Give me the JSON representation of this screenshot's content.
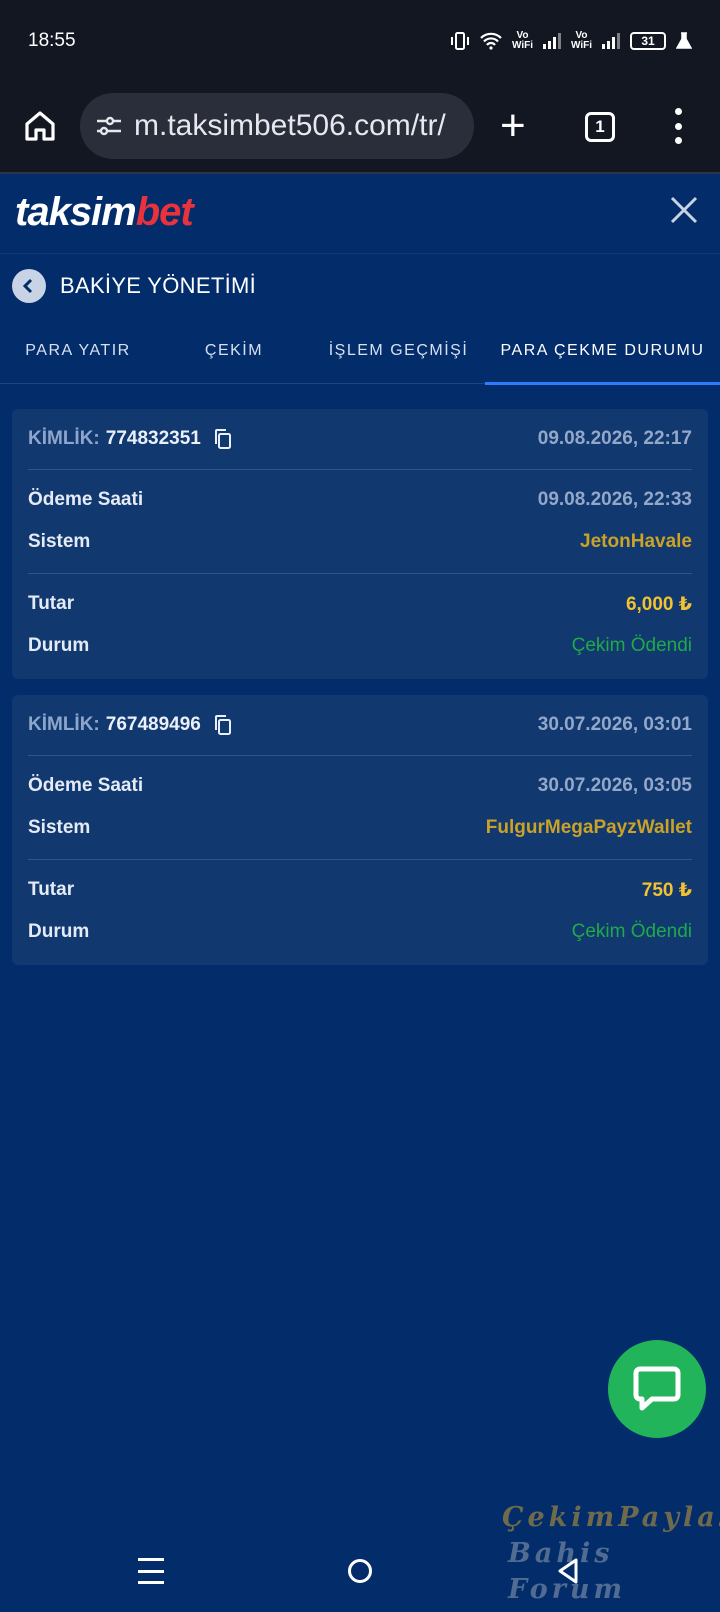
{
  "status_bar": {
    "time": "18:55",
    "vowifi_1": "Vo\nWiFi",
    "vowifi_2": "Vo\nWiFi",
    "battery": "31"
  },
  "browser": {
    "url": "m.taksimbet506.com/tr/",
    "tab_count": "1"
  },
  "site": {
    "logo_part1": "taksim",
    "logo_part2": "bet"
  },
  "page": {
    "title": "BAKİYE YÖNETİMİ",
    "tabs": [
      {
        "label": "PARA YATIR"
      },
      {
        "label": "ÇEKİM"
      },
      {
        "label": "İŞLEM GEÇMİŞİ"
      },
      {
        "label": "PARA ÇEKME DURUMU",
        "active": true
      }
    ]
  },
  "withdrawals": [
    {
      "kimlik_label": "KİMLİK:",
      "kimlik": "774832351",
      "date": "09.08.2026, 22:17",
      "payment_time_label": "Ödeme Saati",
      "payment_time": "09.08.2026, 22:33",
      "system_label": "Sistem",
      "system": "JetonHavale",
      "amount_label": "Tutar",
      "amount": "6,000 ₺",
      "status_label": "Durum",
      "status": "Çekim Ödendi"
    },
    {
      "kimlik_label": "KİMLİK:",
      "kimlik": "767489496",
      "date": "30.07.2026, 03:01",
      "payment_time_label": "Ödeme Saati",
      "payment_time": "30.07.2026, 03:05",
      "system_label": "Sistem",
      "system": "FulgurMegaPayzWallet",
      "amount_label": "Tutar",
      "amount": "750 ₺",
      "status_label": "Durum",
      "status": "Çekim Ödendi"
    }
  ],
  "watermark": {
    "line1": "ÇekimPaylaş",
    "line2": "Bahis Forum"
  },
  "icons": {
    "home": "home-icon",
    "tune": "site-settings-icon",
    "close": "close-icon",
    "back": "chevron-left-icon",
    "copy": "copy-icon",
    "chat": "chat-bubble-icon"
  },
  "colors": {
    "background": "#022c6a",
    "card": "#11386f",
    "accent_tab": "#2f7bff",
    "amount": "#f2c231",
    "system": "#c9a227",
    "status_paid": "#1faa4a",
    "chat_button": "#22b45a",
    "logo_red": "#e8323c"
  }
}
